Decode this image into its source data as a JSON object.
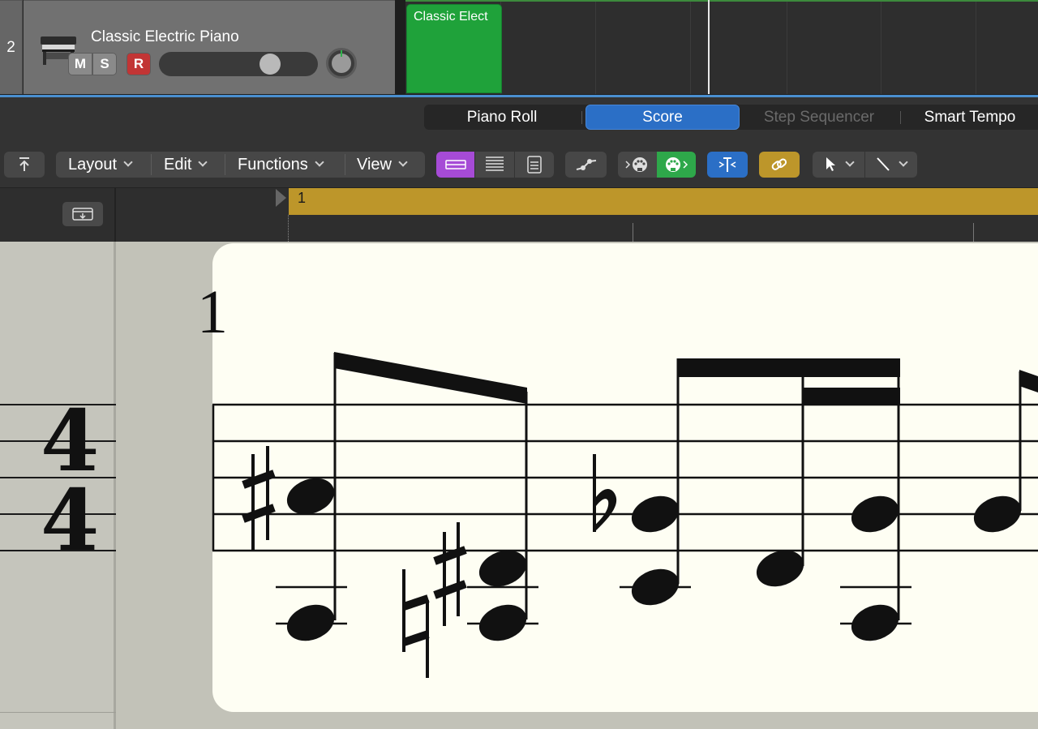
{
  "track": {
    "number": "2",
    "name": "Classic Electric Piano",
    "mute_label": "M",
    "solo_label": "S",
    "record_label": "R",
    "region_label": "Classic Elect",
    "icon": "electric-piano-icon"
  },
  "editor_tabs": {
    "piano_roll": "Piano Roll",
    "score": "Score",
    "step_sequencer": "Step Sequencer",
    "smart_tempo": "Smart Tempo",
    "active": "Score"
  },
  "toolbar": {
    "layout": "Layout",
    "edit": "Edit",
    "functions": "Functions",
    "view": "View",
    "icons": [
      "catch-up-icon",
      "linear-view-icon",
      "wrapped-view-icon",
      "page-view-icon",
      "automation-icon",
      "midi-in-icon",
      "midi-out-icon",
      "snap-icon",
      "link-icon",
      "pointer-tool-icon",
      "pencil-tool-icon"
    ]
  },
  "ruler": {
    "bar_number": "1"
  },
  "score": {
    "measure_number": "1",
    "time_signature_top": "4",
    "time_signature_bottom": "4"
  },
  "colors": {
    "score_tab": "#2b6fc6",
    "region": "#1fa23a",
    "cycle": "#bd962a",
    "record": "#c23535",
    "page": "#fefef3"
  }
}
